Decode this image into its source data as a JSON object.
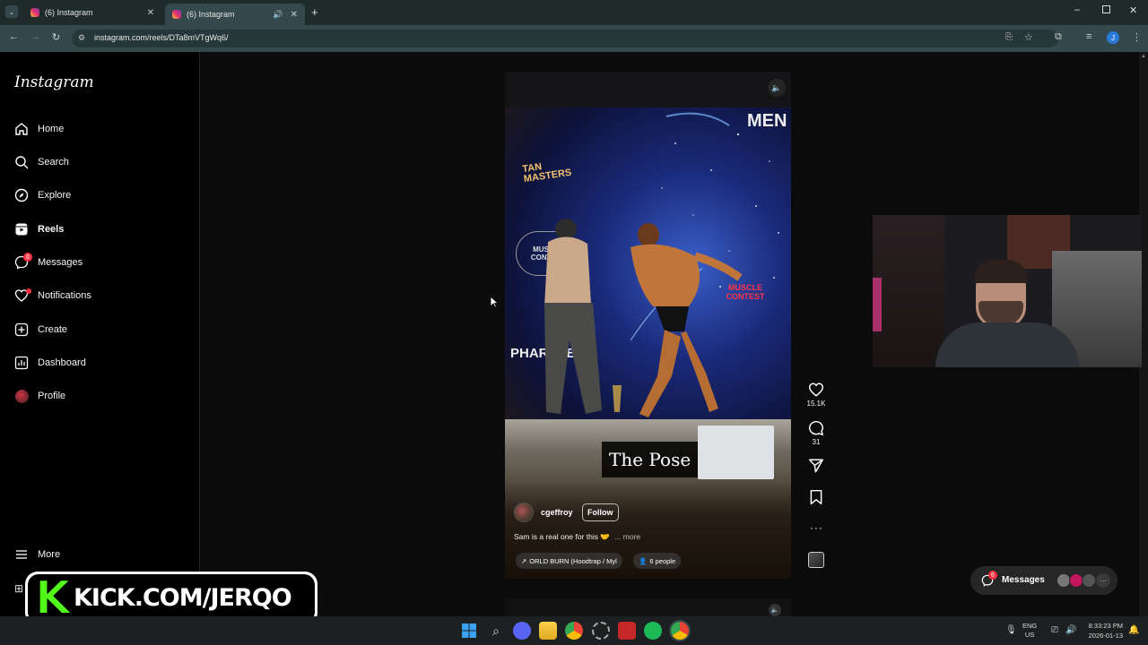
{
  "browser": {
    "tabs": [
      {
        "title": "(6) Instagram",
        "active": false
      },
      {
        "title": "(6) Instagram",
        "active": true
      }
    ],
    "url": "instagram.com/reels/DTa8mVTgWq6/",
    "profile_initial": "J"
  },
  "sidebar": {
    "logo": "Instagram",
    "items": [
      {
        "label": "Home",
        "icon": "home-icon"
      },
      {
        "label": "Search",
        "icon": "search-icon"
      },
      {
        "label": "Explore",
        "icon": "compass-icon"
      },
      {
        "label": "Reels",
        "icon": "reels-icon",
        "active": true
      },
      {
        "label": "Messages",
        "icon": "messenger-icon",
        "badge": "6"
      },
      {
        "label": "Notifications",
        "icon": "heart-icon",
        "dot": true
      },
      {
        "label": "Create",
        "icon": "plus-square-icon"
      },
      {
        "label": "Dashboard",
        "icon": "dashboard-icon"
      },
      {
        "label": "Profile",
        "icon": "avatar-icon"
      }
    ],
    "more": "More"
  },
  "reel": {
    "overlay_text": "The Pose",
    "scene_text": {
      "brand1": "TAN MASTERS",
      "brand2": "MUSCLE CONTEST",
      "brand3": "PHARLAB",
      "corner": "MEN"
    },
    "username": "cgeffroy",
    "follow_label": "Follow",
    "caption": "Sam is a real one for this 🤝",
    "more_label": "... more",
    "audio": "ORLD BURN (Hoodtrap / Myl",
    "people": "6 people",
    "likes": "15.1K",
    "comments": "31"
  },
  "messages_pill": {
    "label": "Messages",
    "badge": "6"
  },
  "overlay": {
    "kick_text": "KICK.COM/JERQO",
    "kick_letter": "K"
  },
  "taskbar": {
    "lang_top": "ENG",
    "lang_bottom": "US",
    "time": "8:33:23 PM",
    "date": "2026-01-13"
  },
  "colors": {
    "accent_badge": "#ff3040",
    "kick_green": "#53fc18",
    "chrome_bg": "#33494b"
  }
}
